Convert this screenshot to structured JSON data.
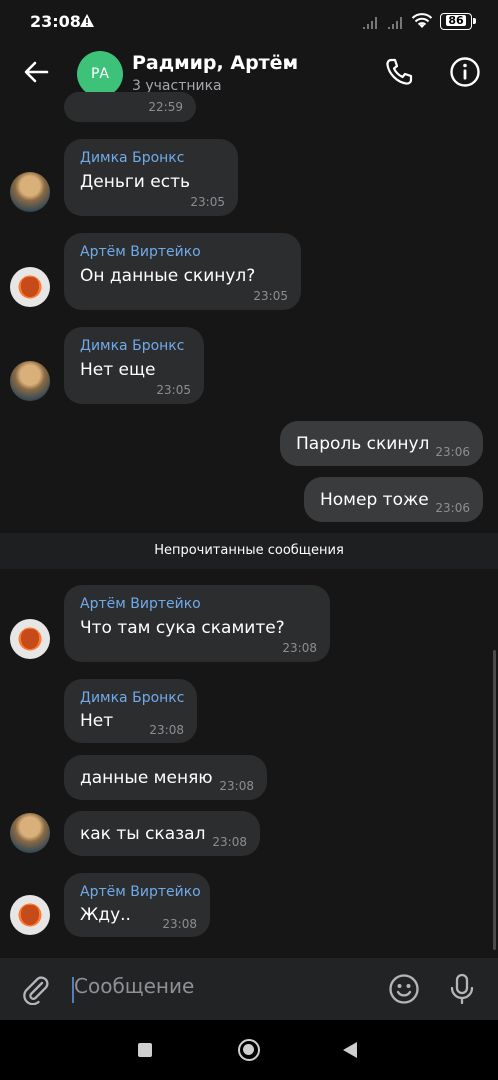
{
  "status": {
    "time": "23:08",
    "battery": "86"
  },
  "header": {
    "avatar_initials": "РА",
    "title": "Радмир, Артём",
    "subtitle": "3 участника"
  },
  "messages": [
    {
      "time": "22:59"
    },
    {
      "sender": "Димка Бронкс",
      "text": "Деньги есть",
      "time": "23:05"
    },
    {
      "sender": "Артём Виртейко",
      "text": "Он данные скинул?",
      "time": "23:05"
    },
    {
      "sender": "Димка Бронкс",
      "text": "Нет еще",
      "time": "23:05"
    },
    {
      "text": "Пароль скинул",
      "time": "23:06"
    },
    {
      "text": "Номер тоже",
      "time": "23:06"
    },
    {
      "sender": "Артём Виртейко",
      "text": "Что там сука скамите?",
      "time": "23:08"
    },
    {
      "sender": "Димка Бронкс",
      "text": "Нет",
      "time": "23:08"
    },
    {
      "text": "данные меняю",
      "time": "23:08"
    },
    {
      "text": "как ты сказал",
      "time": "23:08"
    },
    {
      "sender": "Артём Виртейко",
      "text": "Жду..",
      "time": "23:08"
    }
  ],
  "unread_label": "Непрочитанные сообщения",
  "composer": {
    "placeholder": "Сообщение"
  },
  "colors": {
    "accent": "#71aaeb",
    "avatar_bg": "#3ec27a",
    "bubble_in": "#2c2d2e",
    "bubble_out": "#3a3b3d"
  }
}
